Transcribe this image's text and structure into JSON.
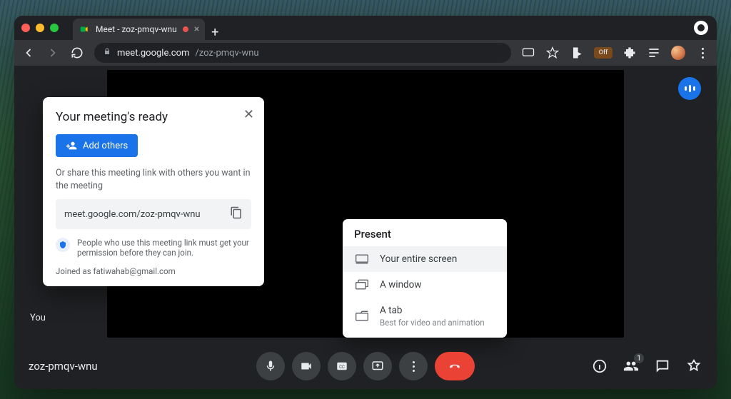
{
  "browser": {
    "tab_title": "Meet - zoz-pmqv-wnu",
    "url_host": "meet.google.com",
    "url_path": "/zoz-pmqv-wnu"
  },
  "meet": {
    "self_label": "You",
    "meeting_code": "zoz-pmqv-wnu",
    "participants_badge": "1"
  },
  "ready_card": {
    "title": "Your meeting's ready",
    "add_others_label": "Add others",
    "share_text": "Or share this meeting link with others you want in the meeting",
    "link": "meet.google.com/zoz-pmqv-wnu",
    "permission_note": "People who use this meeting link must get your permission before they can join.",
    "joined_as_prefix": "Joined as ",
    "joined_as_email": "fatiwahab@gmail.com"
  },
  "present_menu": {
    "title": "Present",
    "items": [
      {
        "label": "Your entire screen",
        "sub": "",
        "selected": true
      },
      {
        "label": "A window",
        "sub": "",
        "selected": false
      },
      {
        "label": "A tab",
        "sub": "Best for video and animation",
        "selected": false
      }
    ]
  }
}
